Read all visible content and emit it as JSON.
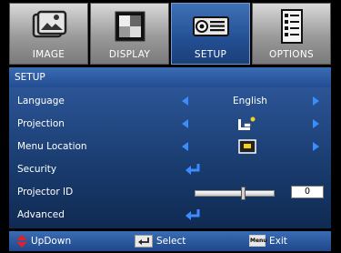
{
  "tabs": [
    {
      "label": "IMAGE",
      "icon": "image-tab-icon",
      "active": false
    },
    {
      "label": "DISPLAY",
      "icon": "display-tab-icon",
      "active": false
    },
    {
      "label": "SETUP",
      "icon": "projector-tab-icon",
      "active": true
    },
    {
      "label": "OPTIONS",
      "icon": "options-tab-icon",
      "active": false
    }
  ],
  "title": "SETUP",
  "menu": {
    "language": {
      "label": "Language",
      "value": "English"
    },
    "projection": {
      "label": "Projection",
      "value_icon": "projection-mode-icon"
    },
    "menu_location": {
      "label": "Menu Location",
      "value_icon": "menu-location-icon"
    },
    "security": {
      "label": "Security",
      "action_icon": "enter-icon"
    },
    "projector_id": {
      "label": "Projector ID",
      "value": "0",
      "level": 0.62
    },
    "advanced": {
      "label": "Advanced",
      "action_icon": "enter-icon"
    }
  },
  "footer": {
    "updown": "UpDown",
    "select": "Select",
    "menu_key": "Menu",
    "exit": "Exit"
  },
  "colors": {
    "accent": "#2a5a9f",
    "arrow": "#3b8cff",
    "updown_key": "#e0202a"
  }
}
